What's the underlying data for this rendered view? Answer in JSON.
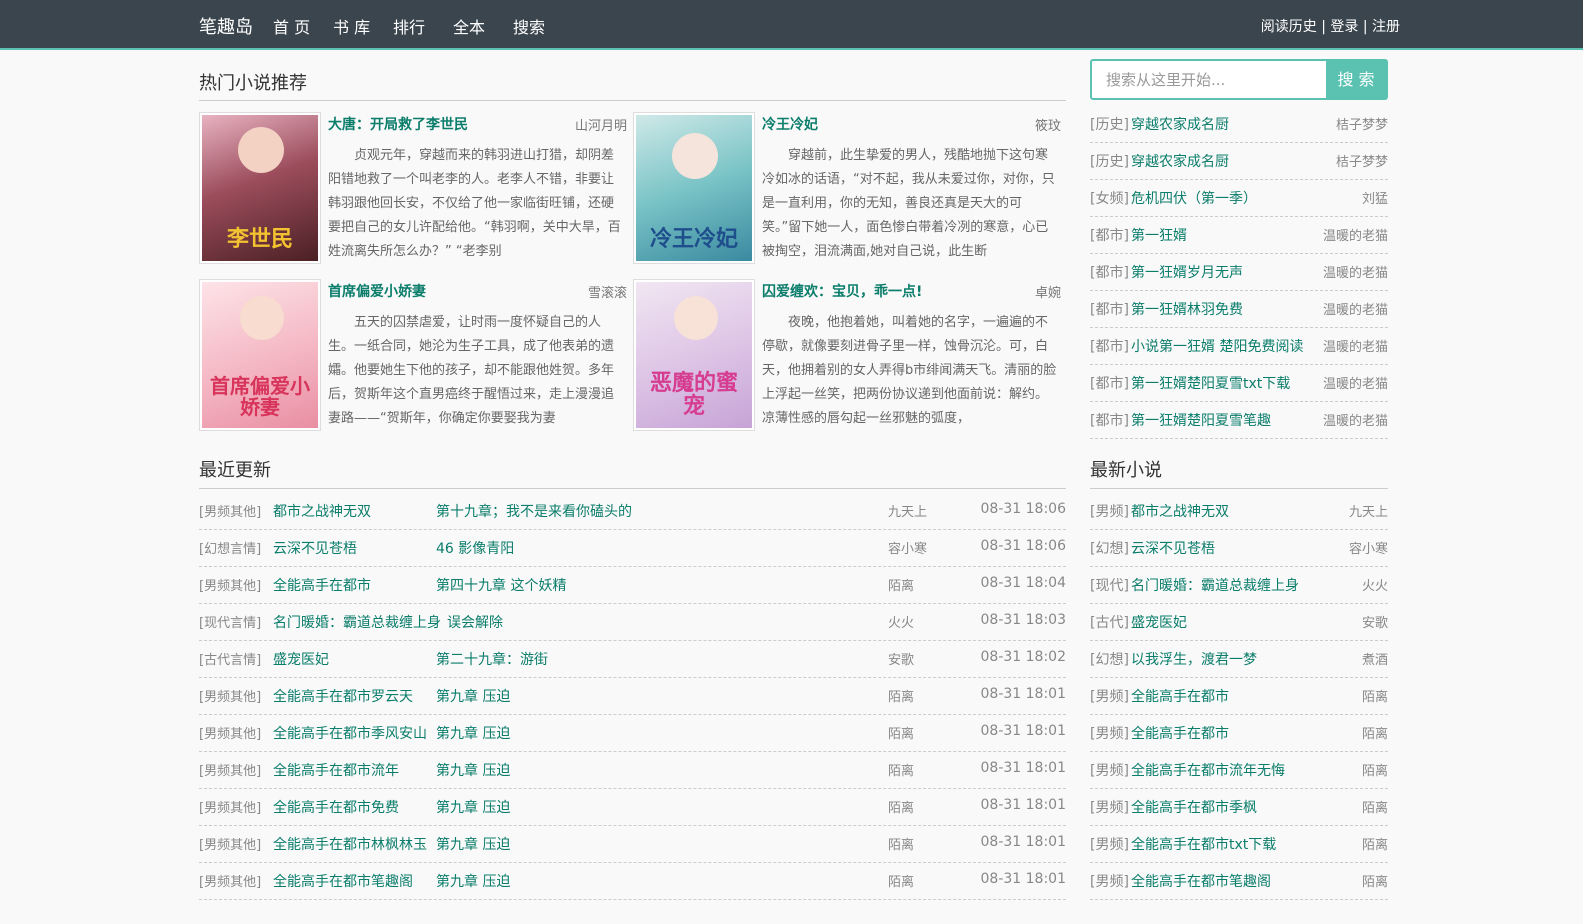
{
  "header": {
    "brand": "笔趣岛",
    "nav": [
      "首 页",
      "书 库",
      "排行",
      "全本",
      "搜索"
    ],
    "account": {
      "history": "阅读历史",
      "sep": " | ",
      "login": "登录",
      "register": "注册"
    }
  },
  "hot": {
    "title": "热门小说推荐",
    "books": [
      {
        "title": "大唐：开局救了李世民",
        "author": "山河月明",
        "cover_text": "李世民",
        "cover_color": "#7a3d4a",
        "desc": "贞观元年，穿越而来的韩羽进山打猎，却阴差阳错地救了一个叫老李的人。老李人不错，非要让韩羽跟他回长安，不仅给了他一家临街旺铺，还硬要把自己的女儿许配给他。“韩羽啊，关中大旱，百姓流离失所怎么办？” “老李别"
      },
      {
        "title": "冷王冷妃",
        "author": "筱玟",
        "cover_text": "冷王冷妃",
        "cover_color": "#5aa9b8",
        "desc": "穿越前，此生挚爱的男人，残酷地抛下这句寒冷如冰的话语，“对不起，我从未爱过你，对你，只是一直利用，你的无知，善良还真是天大的可笑。”留下她一人，面色惨白带着冷冽的寒意，心已被掏空，泪流满面,她对自己说，此生断"
      },
      {
        "title": "首席偏爱小娇妻",
        "author": "雪滚滚",
        "cover_text": "首席偏爱小娇妻",
        "cover_color": "#f3b8c4",
        "desc": "五天的囚禁虐爱，让时雨一度怀疑自己的人生。一纸合同，她沦为生子工具，成了他表弟的遗孀。他要她生下他的孩子，却不能跟他姓贺。多年后，贺斯年这个直男癌终于醒悟过来，走上漫漫追妻路——“贺斯年，你确定你要娶我为妻"
      },
      {
        "title": "囚爱缠欢：宝贝，乖一点!",
        "author": "卓婉",
        "cover_text": "恶魔的蜜宠",
        "cover_color": "#d9c2e3",
        "desc": "夜晚，他抱着她，叫着她的名字，一遍遍的不停歇，就像要刻进骨子里一样，蚀骨沉沦。可，白天，他拥着别的女人弄得b市绯闻满天飞。清丽的脸上浮起一丝笑，把两份协议递到他面前说：解约。凉薄性感的唇勾起一丝邪魅的弧度，"
      }
    ]
  },
  "search": {
    "placeholder": "搜索从这里开始...",
    "button": "搜 索"
  },
  "rank": [
    {
      "cat": "[历史]",
      "title": "穿越农家成名厨",
      "author": "桔子梦梦"
    },
    {
      "cat": "[历史]",
      "title": "穿越农家成名厨",
      "author": "桔子梦梦"
    },
    {
      "cat": "[女频]",
      "title": "危机四伏（第一季）",
      "author": "刘猛"
    },
    {
      "cat": "[都市]",
      "title": "第一狂婿",
      "author": "温暖的老猫"
    },
    {
      "cat": "[都市]",
      "title": "第一狂婿岁月无声",
      "author": "温暖的老猫"
    },
    {
      "cat": "[都市]",
      "title": "第一狂婿林羽免费",
      "author": "温暖的老猫"
    },
    {
      "cat": "[都市]",
      "title": "小说第一狂婿 楚阳免费阅读",
      "author": "温暖的老猫"
    },
    {
      "cat": "[都市]",
      "title": "第一狂婿楚阳夏雪txt下载",
      "author": "温暖的老猫"
    },
    {
      "cat": "[都市]",
      "title": "第一狂婿楚阳夏雪笔趣",
      "author": "温暖的老猫"
    }
  ],
  "recent": {
    "title": "最近更新",
    "rows": [
      {
        "cat": "[男频其他]",
        "title": "都市之战神无双",
        "chapter": "第十九章；我不是来看你磕头的",
        "author": "九天上",
        "time": "08-31 18:06"
      },
      {
        "cat": "[幻想言情]",
        "title": "云深不见苍梧",
        "chapter": "46 影像青阳",
        "author": "容小寒",
        "time": "08-31 18:06"
      },
      {
        "cat": "[男频其他]",
        "title": "全能高手在都市",
        "chapter": "第四十九章 这个妖精",
        "author": "陌离",
        "time": "08-31 18:04"
      },
      {
        "cat": "[现代言情]",
        "title": "名门暖婚：霸道总裁缠上身",
        "chapter": "误会解除",
        "author": "火火",
        "time": "08-31 18:03"
      },
      {
        "cat": "[古代言情]",
        "title": "盛宠医妃",
        "chapter": "第二十九章：游街",
        "author": "安歌",
        "time": "08-31 18:02"
      },
      {
        "cat": "[男频其他]",
        "title": "全能高手在都市罗云天",
        "chapter": "第九章 压迫",
        "author": "陌离",
        "time": "08-31 18:01"
      },
      {
        "cat": "[男频其他]",
        "title": "全能高手在都市季风安山",
        "chapter": "第九章 压迫",
        "author": "陌离",
        "time": "08-31 18:01"
      },
      {
        "cat": "[男频其他]",
        "title": "全能高手在都市流年",
        "chapter": "第九章 压迫",
        "author": "陌离",
        "time": "08-31 18:01"
      },
      {
        "cat": "[男频其他]",
        "title": "全能高手在都市免费",
        "chapter": "第九章 压迫",
        "author": "陌离",
        "time": "08-31 18:01"
      },
      {
        "cat": "[男频其他]",
        "title": "全能高手在都市林枫林玉",
        "chapter": "第九章 压迫",
        "author": "陌离",
        "time": "08-31 18:01"
      },
      {
        "cat": "[男频其他]",
        "title": "全能高手在都市笔趣阁",
        "chapter": "第九章 压迫",
        "author": "陌离",
        "time": "08-31 18:01"
      }
    ]
  },
  "latest": {
    "title": "最新小说",
    "rows": [
      {
        "cat": "[男频]",
        "title": "都市之战神无双",
        "author": "九天上"
      },
      {
        "cat": "[幻想]",
        "title": "云深不见苍梧",
        "author": "容小寒"
      },
      {
        "cat": "[现代]",
        "title": "名门暖婚：霸道总裁缠上身",
        "author": "火火"
      },
      {
        "cat": "[古代]",
        "title": "盛宠医妃",
        "author": "安歌"
      },
      {
        "cat": "[幻想]",
        "title": "以我浮生，渡君一梦",
        "author": "煮酒"
      },
      {
        "cat": "[男频]",
        "title": "全能高手在都市",
        "author": "陌离"
      },
      {
        "cat": "[男频]",
        "title": "全能高手在都市",
        "author": "陌离"
      },
      {
        "cat": "[男频]",
        "title": "全能高手在都市流年无悔",
        "author": "陌离"
      },
      {
        "cat": "[男频]",
        "title": "全能高手在都市季枫",
        "author": "陌离"
      },
      {
        "cat": "[男频]",
        "title": "全能高手在都市txt下载",
        "author": "陌离"
      },
      {
        "cat": "[男频]",
        "title": "全能高手在都市笔趣阁",
        "author": "陌离"
      }
    ]
  }
}
